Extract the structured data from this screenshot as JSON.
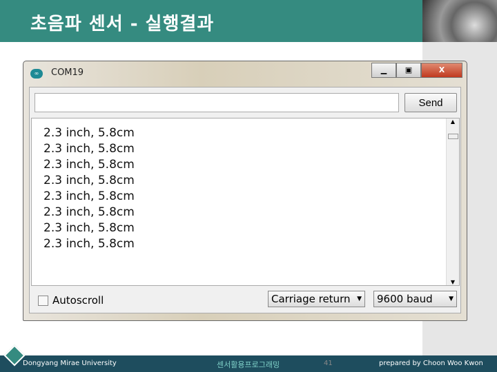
{
  "slide": {
    "title": "초음파 센서 - 실행결과"
  },
  "window": {
    "title": "COM19",
    "send_label": "Send",
    "input_value": "",
    "output_lines": [
      "2.3 inch, 5.8cm",
      "2.3 inch, 5.8cm",
      "2.3 inch, 5.8cm",
      "2.3 inch, 5.8cm",
      "2.3 inch, 5.8cm",
      "2.3 inch, 5.8cm",
      "2.3 inch, 5.8cm",
      "2.3 inch, 5.8cm"
    ],
    "autoscroll_label": "Autoscroll",
    "line_ending": "Carriage return",
    "baud": "9600 baud"
  },
  "footer": {
    "university": "Dongyang Mirae University",
    "course": "센서활용프로그래밍",
    "page": "41",
    "author": "prepared by Choon Woo Kwon"
  }
}
